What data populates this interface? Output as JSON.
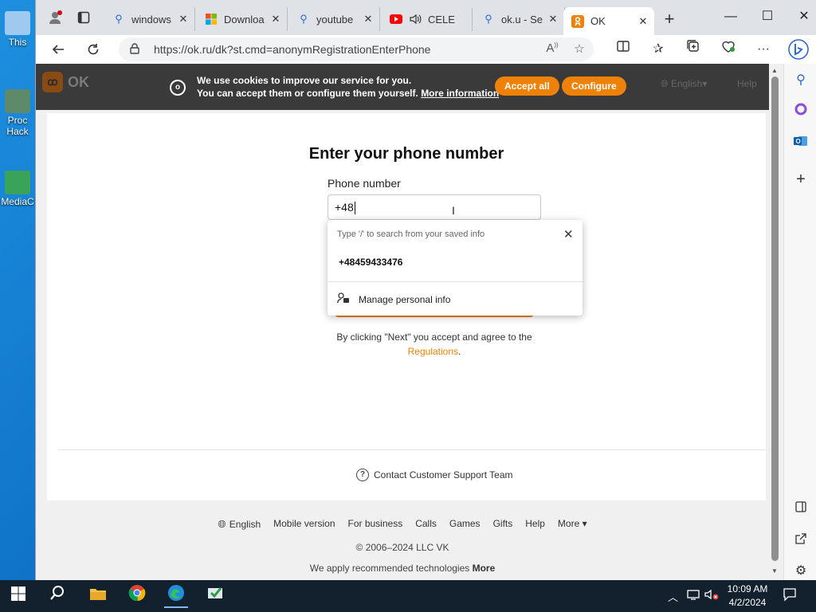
{
  "desktop": {
    "icons": [
      {
        "label": "This",
        "icon": "this-pc-icon"
      },
      {
        "label": "Proc Hack",
        "icon": "process-hacker-icon"
      },
      {
        "label": "MediaC",
        "icon": "media-creation-tool-icon"
      }
    ]
  },
  "browser": {
    "tabs": [
      {
        "label": "windows",
        "icon": "search-icon"
      },
      {
        "label": "Downloa",
        "icon": "microsoft-icon"
      },
      {
        "label": "youtube",
        "icon": "search-icon"
      },
      {
        "label": "CELE",
        "icon": "youtube-icon"
      },
      {
        "label": "ok.u - Se",
        "icon": "search-icon"
      },
      {
        "label": "OK",
        "icon": "ok-icon"
      }
    ],
    "url": "https://ok.ru/dk?st.cmd=anonymRegistrationEnterPhone",
    "accent": "#ee8208"
  },
  "okheader": {
    "logo_text": "OK",
    "cookie_line1": "We use cookies to improve our service for you.",
    "cookie_line2": "You can accept them or configure them yourself.",
    "more_info": "More information",
    "accept_all": "Accept all",
    "configure": "Configure",
    "language": "English",
    "help": "Help"
  },
  "form": {
    "title": "Enter your phone number",
    "phone_label": "Phone number",
    "phone_value": "+48",
    "terms_text": "By clicking \"Next\" you accept and agree to the",
    "terms_link": "Regulations",
    "terms_end": "."
  },
  "autofill": {
    "hint": "Type '/' to search from your saved info",
    "suggestion": "+48459433476",
    "manage": "Manage personal info"
  },
  "support": {
    "label": "Contact Customer Support Team"
  },
  "footer": {
    "links": [
      "English",
      "Mobile version",
      "For business",
      "Calls",
      "Games",
      "Gifts",
      "Help",
      "More"
    ],
    "copyright": "© 2006–2024 LLC VK",
    "tech_text": "We apply recommended technologies",
    "tech_more": "More"
  },
  "taskbar": {
    "time": "10:09 AM",
    "date": "4/2/2024"
  }
}
